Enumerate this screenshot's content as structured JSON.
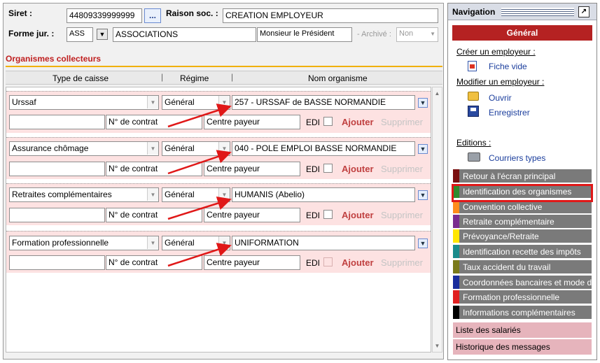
{
  "header": {
    "siret_label": "Siret :",
    "siret_value": "44809339999999",
    "browse_label": "...",
    "raison_label": "Raison soc. :",
    "raison_value": "CREATION EMPLOYEUR",
    "forme_label": "Forme jur. :",
    "forme_code": "ASS",
    "forme_value": "ASSOCIATIONS",
    "contact_value": "Monsieur le Président",
    "archive_label": "- Archivé :",
    "archive_value": "Non"
  },
  "section_title": "Organismes collecteurs",
  "columns": [
    "Type de caisse",
    "Régime",
    "Nom organisme"
  ],
  "rows": [
    {
      "type": "Urssaf",
      "regime": "Général",
      "organisme": "257 - URSSAF de BASSE NORMANDIE"
    },
    {
      "type": "Assurance chômage",
      "regime": "Général",
      "organisme": "040 - POLE EMPLOI BASSE NORMANDIE"
    },
    {
      "type": "Retraites complémentaires",
      "regime": "Général",
      "organisme": "HUMANIS (Abelio)"
    },
    {
      "type": "Formation professionnelle",
      "regime": "Général",
      "organisme": "UNIFORMATION"
    }
  ],
  "row_labels": {
    "contrat": "N° de contrat",
    "centre": "Centre payeur",
    "edi": "EDI",
    "ajouter": "Ajouter",
    "supprimer": "Supprimer"
  },
  "nav": {
    "title": "Navigation",
    "general": "Général",
    "creer_label": "Créer un employeur :",
    "fiche_vide": "Fiche vide",
    "modifier_label": "Modifier un employeur :",
    "ouvrir": "Ouvrir",
    "enregistrer": "Enregistrer",
    "editions_label": "Editions :",
    "courriers": "Courriers types",
    "items": [
      {
        "label": "Retour à l'écran principal",
        "color": "#7a1010"
      },
      {
        "label": "Identification des organismes",
        "color": "#2e8b2e"
      },
      {
        "label": "Convention collective",
        "color": "#ff8c1a"
      },
      {
        "label": "Retraite complémentaire",
        "color": "#7b2c8f"
      },
      {
        "label": "Prévoyance/Retraite",
        "color": "#ffe600"
      },
      {
        "label": "Identification recette des impôts",
        "color": "#1a8c8c"
      },
      {
        "label": "Taux accident du travail",
        "color": "#7a7a1a"
      },
      {
        "label": "Coordonnées bancaires et mode de",
        "color": "#1a2d9c"
      },
      {
        "label": "Formation professionnelle",
        "color": "#e02020"
      },
      {
        "label": "Informations complémentaires",
        "color": "#000000"
      }
    ],
    "liste_salaries": "Liste des salariés",
    "historique": "Historique des messages"
  },
  "colors": {
    "accent": "#b52222",
    "highlight": "#e01818",
    "row_bg": "#fde2e2",
    "ajouter": "#c04040"
  }
}
